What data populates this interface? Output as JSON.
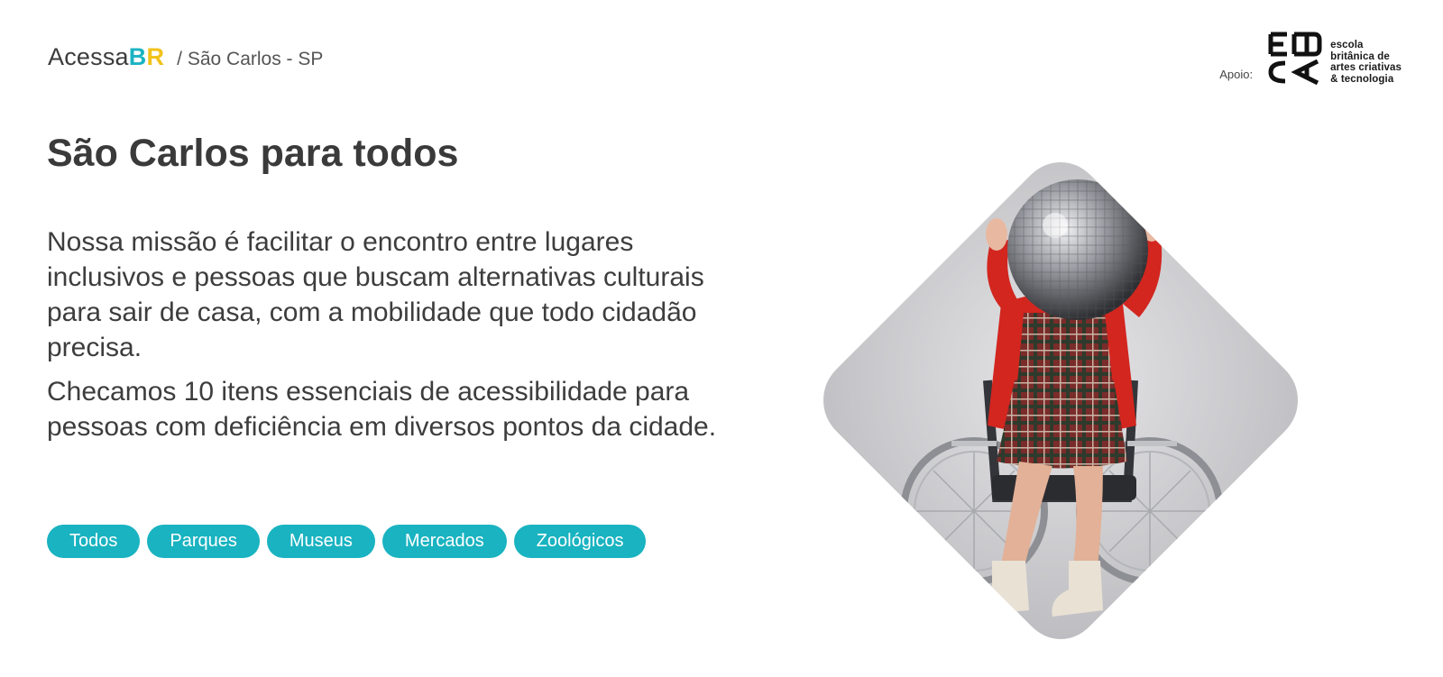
{
  "header": {
    "logo_prefix": "Acessa",
    "logo_b": "B",
    "logo_r": "R",
    "breadcrumb": "/ São Carlos - SP",
    "sponsor_label": "Apoio:",
    "sponsor_lines": [
      "escola",
      "britânica de",
      "artes criativas",
      "& tecnologia"
    ]
  },
  "main": {
    "title": "São Carlos para todos",
    "paragraphs": [
      "Nossa missão é facilitar o encontro entre lugares inclusivos e pessoas que buscam alternativas culturais para sair de casa, com a mobilidade que todo cidadão precisa.",
      "Checamos 10 itens essenciais de acessibilidade para pessoas com deficiência em diversos pontos da cidade."
    ],
    "filters": [
      "Todos",
      "Parques",
      "Museus",
      "Mercados",
      "Zoológicos"
    ]
  },
  "colors": {
    "accent_teal": "#19b3c1",
    "accent_yellow": "#f2c21b",
    "text_dark": "#3a3a3a"
  },
  "icons": {
    "sponsor_logo": "ebac-logo",
    "hero": "person-in-wheelchair-holding-disco-ball-photo"
  }
}
